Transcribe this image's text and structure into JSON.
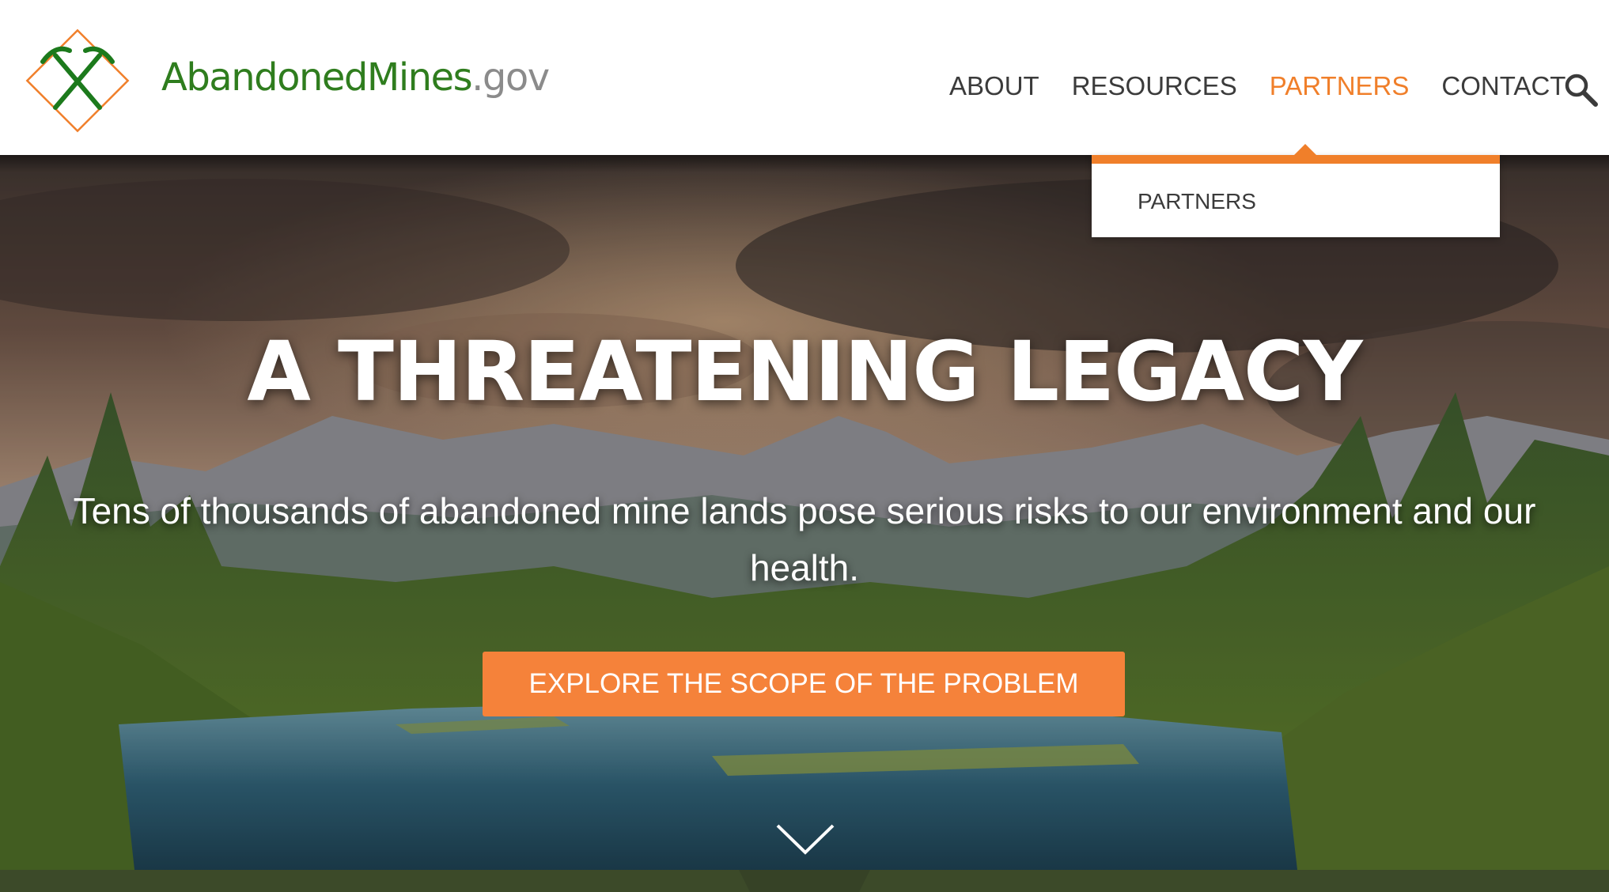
{
  "header": {
    "logo_name": "AbandonedMines",
    "logo_tld": ".gov",
    "nav": [
      {
        "label": "ABOUT"
      },
      {
        "label": "RESOURCES"
      },
      {
        "label": "PARTNERS"
      },
      {
        "label": "CONTACT"
      }
    ],
    "active_nav": "PARTNERS",
    "search_icon": "search-icon"
  },
  "dropdown": {
    "items": [
      {
        "label": "PARTNERS"
      }
    ]
  },
  "hero": {
    "title": "A THREATENING LEGACY",
    "subtitle": "Tens of thousands of abandoned mine lands pose serious risks to our environment and our health.",
    "cta_label": "EXPLORE THE SCOPE OF THE PROBLEM",
    "scroll_icon": "chevron-down-icon",
    "background": "mountain-lake-forest-photo"
  },
  "colors": {
    "brand_green": "#2f7d1e",
    "accent_orange": "#f07f2a",
    "cta_orange": "#f5823a",
    "nav_text": "#3b3b3b",
    "band_green": "#3c4a29"
  }
}
